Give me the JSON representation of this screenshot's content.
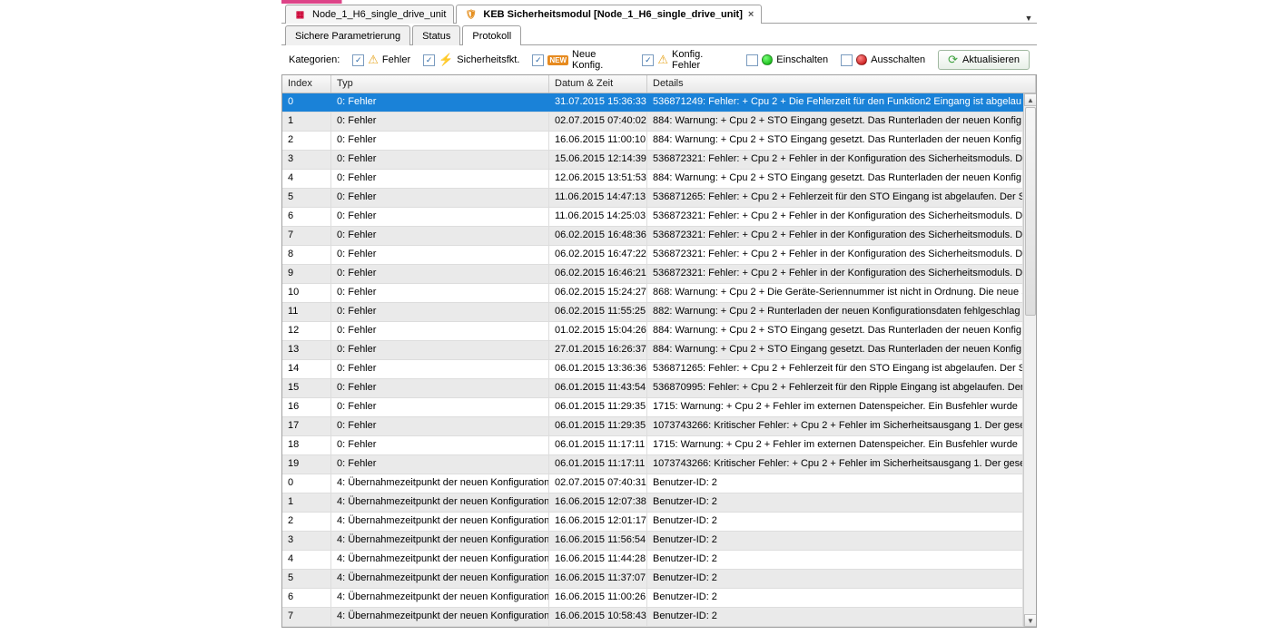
{
  "editorTabs": [
    {
      "label": "Node_1_H6_single_drive_unit",
      "active": false
    },
    {
      "label": "KEB Sicherheitsmodul [Node_1_H6_single_drive_unit]",
      "active": true
    }
  ],
  "subTabs": [
    {
      "label": "Sichere Parametrierung",
      "active": false
    },
    {
      "label": "Status",
      "active": false
    },
    {
      "label": "Protokoll",
      "active": true
    }
  ],
  "filterBar": {
    "label": "Kategorien:",
    "items": [
      {
        "key": "fehler",
        "label": "Fehler",
        "checked": true,
        "icon": "error"
      },
      {
        "key": "sicherheitsfkt",
        "label": "Sicherheitsfkt.",
        "checked": true,
        "icon": "flash"
      },
      {
        "key": "neuekonfig",
        "label": "Neue Konfig.",
        "checked": true,
        "icon": "new"
      },
      {
        "key": "konfigfehler",
        "label": "Konfig. Fehler",
        "checked": true,
        "icon": "warn"
      },
      {
        "key": "einschalten",
        "label": "Einschalten",
        "checked": false,
        "icon": "on"
      },
      {
        "key": "ausschalten",
        "label": "Ausschalten",
        "checked": false,
        "icon": "off"
      }
    ],
    "refresh": "Aktualisieren"
  },
  "columns": [
    "Index",
    "Typ",
    "Datum & Zeit",
    "Details"
  ],
  "rows": [
    {
      "idx": "0",
      "typ": "0: Fehler",
      "dt": "31.07.2015 15:36:33",
      "det": "536871249: Fehler: + Cpu 2 + Die Fehlerzeit für den Funktion2 Eingang ist abgelau",
      "sel": true
    },
    {
      "idx": "1",
      "typ": "0: Fehler",
      "dt": "02.07.2015 07:40:02",
      "det": "884: Warnung: + Cpu 2 + STO Eingang gesetzt. Das Runterladen der neuen Konfig"
    },
    {
      "idx": "2",
      "typ": "0: Fehler",
      "dt": "16.06.2015 11:00:10",
      "det": "884: Warnung: + Cpu 2 + STO Eingang gesetzt. Das Runterladen der neuen Konfig"
    },
    {
      "idx": "3",
      "typ": "0: Fehler",
      "dt": "15.06.2015 12:14:39",
      "det": "536872321: Fehler: + Cpu 2 + Fehler in der Konfiguration des Sicherheitsmoduls. Di"
    },
    {
      "idx": "4",
      "typ": "0: Fehler",
      "dt": "12.06.2015 13:51:53",
      "det": "884: Warnung: + Cpu 2 + STO Eingang gesetzt. Das Runterladen der neuen Konfig"
    },
    {
      "idx": "5",
      "typ": "0: Fehler",
      "dt": "11.06.2015 14:47:13",
      "det": "536871265: Fehler: + Cpu 2 + Fehlerzeit für den STO Eingang ist abgelaufen. Der S"
    },
    {
      "idx": "6",
      "typ": "0: Fehler",
      "dt": "11.06.2015 14:25:03",
      "det": "536872321: Fehler: + Cpu 2 + Fehler in der Konfiguration des Sicherheitsmoduls. Di"
    },
    {
      "idx": "7",
      "typ": "0: Fehler",
      "dt": "06.02.2015 16:48:36",
      "det": "536872321: Fehler: + Cpu 2 + Fehler in der Konfiguration des Sicherheitsmoduls. Di"
    },
    {
      "idx": "8",
      "typ": "0: Fehler",
      "dt": "06.02.2015 16:47:22",
      "det": "536872321: Fehler: + Cpu 2 + Fehler in der Konfiguration des Sicherheitsmoduls. Di"
    },
    {
      "idx": "9",
      "typ": "0: Fehler",
      "dt": "06.02.2015 16:46:21",
      "det": "536872321: Fehler: + Cpu 2 + Fehler in der Konfiguration des Sicherheitsmoduls. Di"
    },
    {
      "idx": "10",
      "typ": "0: Fehler",
      "dt": "06.02.2015 15:24:27",
      "det": "868: Warnung: + Cpu 2 + Die Geräte-Seriennummer ist nicht in Ordnung. Die neue S"
    },
    {
      "idx": "11",
      "typ": "0: Fehler",
      "dt": "06.02.2015 11:55:25",
      "det": "882: Warnung: + Cpu 2 + Runterladen der neuen Konfigurationsdaten fehlgeschlag"
    },
    {
      "idx": "12",
      "typ": "0: Fehler",
      "dt": "01.02.2015 15:04:26",
      "det": "884: Warnung: + Cpu 2 + STO Eingang gesetzt. Das Runterladen der neuen Konfig"
    },
    {
      "idx": "13",
      "typ": "0: Fehler",
      "dt": "27.01.2015 16:26:37",
      "det": "884: Warnung: + Cpu 2 + STO Eingang gesetzt. Das Runterladen der neuen Konfig"
    },
    {
      "idx": "14",
      "typ": "0: Fehler",
      "dt": "06.01.2015 13:36:36",
      "det": "536871265: Fehler: + Cpu 2 + Fehlerzeit für den STO Eingang ist abgelaufen. Der S"
    },
    {
      "idx": "15",
      "typ": "0: Fehler",
      "dt": "06.01.2015 11:43:54",
      "det": "536870995: Fehler: + Cpu 2 + Fehlerzeit für den Ripple Eingang ist abgelaufen. Der"
    },
    {
      "idx": "16",
      "typ": "0: Fehler",
      "dt": "06.01.2015 11:29:35",
      "det": "1715: Warnung: + Cpu 2 + Fehler im externen Datenspeicher. Ein Busfehler wurde"
    },
    {
      "idx": "17",
      "typ": "0: Fehler",
      "dt": "06.01.2015 11:29:35",
      "det": "1073743266: Kritischer Fehler: + Cpu 2 + Fehler im Sicherheitsausgang 1. Der gese"
    },
    {
      "idx": "18",
      "typ": "0: Fehler",
      "dt": "06.01.2015 11:17:11",
      "det": "1715: Warnung: + Cpu 2 + Fehler im externen Datenspeicher. Ein Busfehler wurde"
    },
    {
      "idx": "19",
      "typ": "0: Fehler",
      "dt": "06.01.2015 11:17:11",
      "det": "1073743266: Kritischer Fehler: + Cpu 2 + Fehler im Sicherheitsausgang 1. Der gese"
    },
    {
      "idx": "0",
      "typ": "4: Übernahmezeitpunkt der neuen Konfiguration",
      "dt": "02.07.2015 07:40:31",
      "det": "Benutzer-ID: 2"
    },
    {
      "idx": "1",
      "typ": "4: Übernahmezeitpunkt der neuen Konfiguration",
      "dt": "16.06.2015 12:07:38",
      "det": "Benutzer-ID: 2"
    },
    {
      "idx": "2",
      "typ": "4: Übernahmezeitpunkt der neuen Konfiguration",
      "dt": "16.06.2015 12:01:17",
      "det": "Benutzer-ID: 2"
    },
    {
      "idx": "3",
      "typ": "4: Übernahmezeitpunkt der neuen Konfiguration",
      "dt": "16.06.2015 11:56:54",
      "det": "Benutzer-ID: 2"
    },
    {
      "idx": "4",
      "typ": "4: Übernahmezeitpunkt der neuen Konfiguration",
      "dt": "16.06.2015 11:44:28",
      "det": "Benutzer-ID: 2"
    },
    {
      "idx": "5",
      "typ": "4: Übernahmezeitpunkt der neuen Konfiguration",
      "dt": "16.06.2015 11:37:07",
      "det": "Benutzer-ID: 2"
    },
    {
      "idx": "6",
      "typ": "4: Übernahmezeitpunkt der neuen Konfiguration",
      "dt": "16.06.2015 11:00:26",
      "det": "Benutzer-ID: 2"
    },
    {
      "idx": "7",
      "typ": "4: Übernahmezeitpunkt der neuen Konfiguration",
      "dt": "16.06.2015 10:58:43",
      "det": "Benutzer-ID: 2"
    }
  ]
}
